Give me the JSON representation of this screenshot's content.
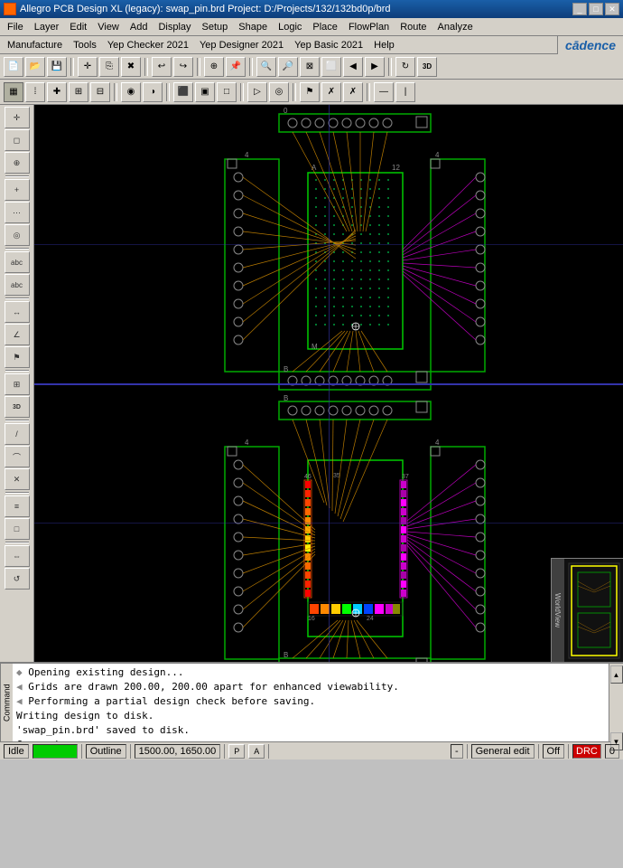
{
  "titlebar": {
    "title": "Allegro PCB Design XL (legacy): swap_pin.brd  Project: D:/Projects/132/132bd0p/brd",
    "icon": "allegro-icon",
    "controls": [
      "minimize",
      "maximize",
      "close"
    ]
  },
  "menubar1": {
    "items": [
      "File",
      "Layer",
      "Edit",
      "View",
      "Add",
      "Display",
      "Setup",
      "Shape",
      "Logic",
      "Place",
      "FlowPlan",
      "Route",
      "Analyze"
    ]
  },
  "menubar2": {
    "items": [
      "Manufacture",
      "Tools",
      "Yep Checker 2021",
      "Yep Designer 2021",
      "Yep Basic 2021",
      "Help"
    ],
    "logo": "cādence"
  },
  "toolbar1": {
    "buttons": [
      "new",
      "open",
      "save",
      "select",
      "copy",
      "delete",
      "undo",
      "redo",
      "snap",
      "pin",
      "add-line",
      "zoom-in",
      "zoom-out",
      "zoom-fit",
      "zoom-box",
      "pan",
      "refresh",
      "3d"
    ]
  },
  "toolbar2": {
    "buttons": [
      "grid-on",
      "grid-dots",
      "grid-cross",
      "snap-grid",
      "snap-off",
      "highlight",
      "dark",
      "select-all",
      "window",
      "deselect",
      "add-shape",
      "via",
      "drc",
      "x1",
      "x2"
    ]
  },
  "console": {
    "label": "Command",
    "lines": [
      "Opening existing design...",
      "Grids are drawn 200.00, 200.00 apart for enhanced viewability.",
      "Performing a partial design check before saving.",
      "Writing design to disk.",
      "'swap_pin.brd' saved to disk.",
      "Command >"
    ],
    "console_icon": "◀"
  },
  "statusbar": {
    "mode": "Idle",
    "indicator": "",
    "view": "Outline",
    "coords": "1500.00, 1650.00",
    "p_btn": "P",
    "a_btn": "A",
    "separator1": "-",
    "edit_mode": "General edit",
    "off_label": "Off",
    "drc_label": "DRC",
    "drc_count": "0"
  },
  "minimap": {
    "label": "WorldView",
    "viewport_color": "#ffff00"
  },
  "pcb": {
    "background": "#000000",
    "crosshair_color": "#3030a0"
  }
}
